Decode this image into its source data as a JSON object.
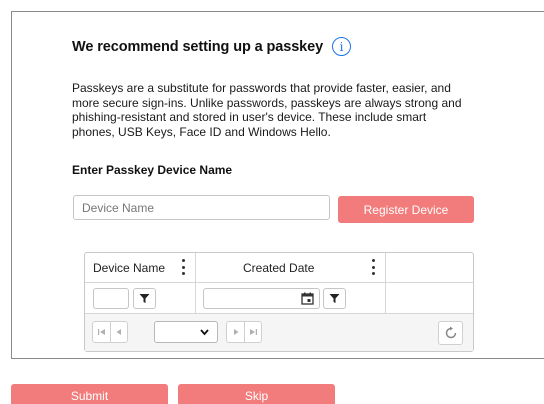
{
  "card": {
    "title": "We recommend setting up a passkey",
    "info_icon": "info-icon",
    "description": "Passkeys are a substitute for passwords that provide faster, easier, and more secure sign-ins. Unlike passwords, passkeys are always strong and phishing-resistant and stored in user's device. These include smart phones, USB Keys, Face ID and Windows Hello.",
    "section_label": "Enter Passkey Device Name",
    "device_input": {
      "value": "",
      "placeholder": "Device Name"
    },
    "register_label": "Register Device"
  },
  "grid": {
    "columns": [
      {
        "label": "Device Name"
      },
      {
        "label": "Created Date"
      }
    ],
    "icons": [
      "kebab-menu-icon",
      "filter-icon",
      "calendar-icon",
      "first-page-icon",
      "prev-page-icon",
      "chevron-down-icon",
      "next-page-icon",
      "last-page-icon",
      "refresh-icon"
    ],
    "pager": {
      "page_size": ""
    }
  },
  "actions": {
    "submit_label": "Submit",
    "skip_label": "Skip"
  },
  "colors": {
    "accent_button": "#f27b7b",
    "info_blue": "#1a73e8",
    "border": "#8a8a8a"
  }
}
